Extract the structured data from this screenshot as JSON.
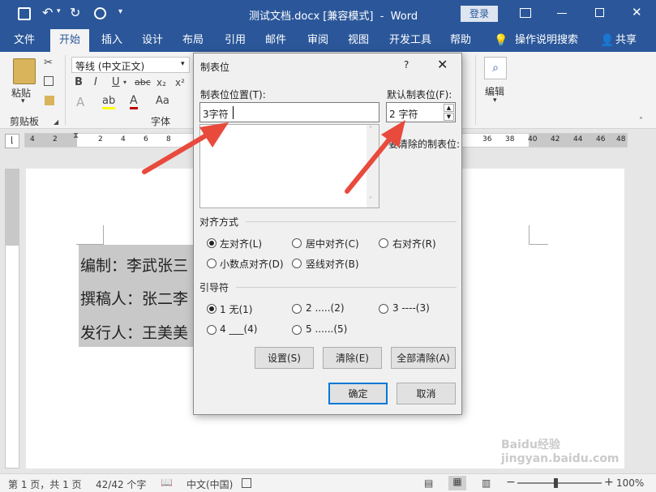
{
  "app": {
    "doc_title": "测试文档.docx [兼容模式]  -  Word",
    "login": "登录"
  },
  "tabs": [
    "文件",
    "开始",
    "插入",
    "设计",
    "布局",
    "引用",
    "邮件",
    "审阅",
    "视图",
    "开发工具",
    "帮助"
  ],
  "tell_me": "操作说明搜索",
  "share": "共享",
  "ribbon": {
    "paste": "粘贴",
    "clipboard": "剪贴板",
    "font_name": "等线 (中文正文)",
    "font_group": "字体",
    "editing": "编辑"
  },
  "ruler": {
    "h_ticks": [
      "4",
      "2",
      "2",
      "4",
      "6",
      "8",
      "36",
      "38",
      "40",
      "42",
      "44",
      "46",
      "48"
    ]
  },
  "document": {
    "lines": [
      "编制：李武张三",
      "撰稿人：张二李",
      "发行人：王美美"
    ]
  },
  "status": {
    "page": "第 1 页，共 1 页",
    "words": "42/42 个字",
    "lang": "中文(中国)",
    "zoom": "100%"
  },
  "dialog": {
    "title": "制表位",
    "help": "?",
    "tab_pos_label": "制表位位置(T):",
    "tab_pos_value": "3字符",
    "default_label": "默认制表位(F):",
    "default_value": "2 字符",
    "clear_label": "要清除的制表位:",
    "align_title": "对齐方式",
    "align": [
      "左对齐(L)",
      "居中对齐(C)",
      "右对齐(R)",
      "小数点对齐(D)",
      "竖线对齐(B)"
    ],
    "leader_title": "引导符",
    "leader": [
      "1 无(1)",
      "2 .....(2)",
      "3 ----(3)",
      "4 ___(4)",
      "5 ......(5)"
    ],
    "set": "设置(S)",
    "clear": "清除(E)",
    "clear_all": "全部清除(A)",
    "ok": "确定",
    "cancel": "取消"
  },
  "watermark": "Baidu经验  jingyan.baidu.com",
  "colors": {
    "accent": "#2b579a",
    "arrow": "#e84a3c"
  }
}
